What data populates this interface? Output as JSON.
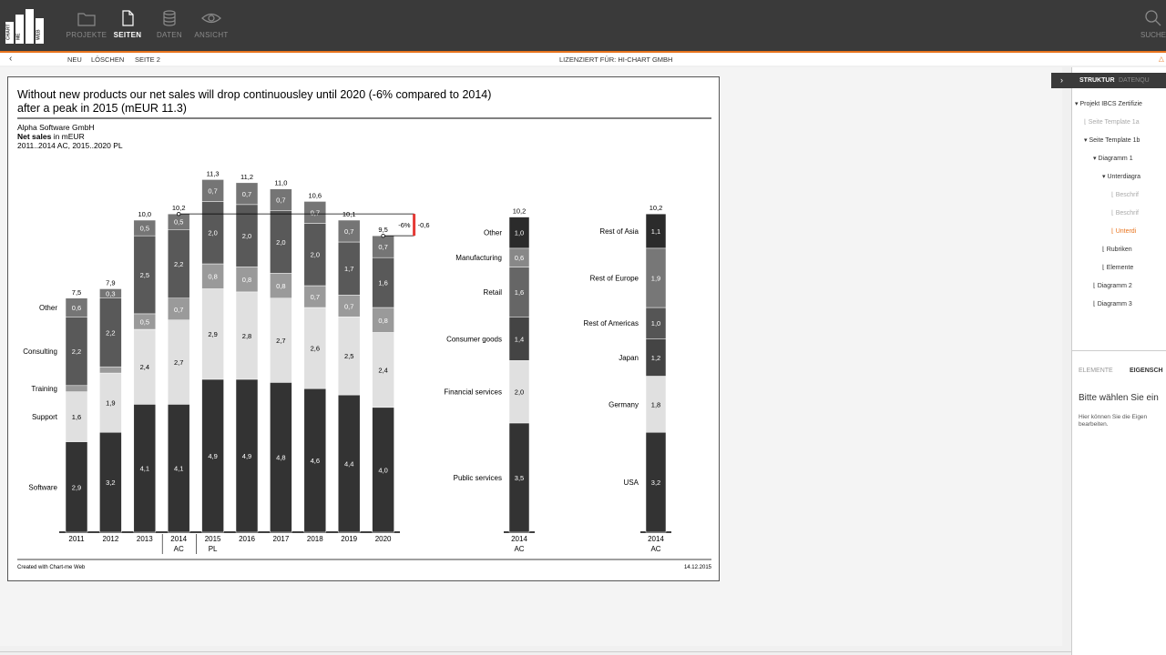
{
  "app": {
    "nav": [
      {
        "label": "PROJEKTE",
        "icon": "folder-icon",
        "active": false
      },
      {
        "label": "SEITEN",
        "icon": "page-icon",
        "active": true
      },
      {
        "label": "DATEN",
        "icon": "database-icon",
        "active": false
      },
      {
        "label": "ANSICHT",
        "icon": "eye-icon",
        "active": false
      }
    ],
    "search_label": "SUCHE",
    "accent_color": "#e8741e"
  },
  "subbar": {
    "new": "NEU",
    "delete": "LÖSCHEN",
    "page": "SEITE 2",
    "license": "LIZENZIERT FÜR: HI-CHART GMBH"
  },
  "right_panel": {
    "tabs": [
      "STRUKTUR",
      "DATENQU"
    ],
    "tree": [
      {
        "label": "Projekt IBCS Zertifizie",
        "level": 0,
        "state": "open"
      },
      {
        "label": "Seite Template 1a",
        "level": 1,
        "state": "leaf-muted"
      },
      {
        "label": "Seite Template 1b",
        "level": 1,
        "state": "open"
      },
      {
        "label": "Diagramm 1",
        "level": 2,
        "state": "open"
      },
      {
        "label": "Unterdiagra",
        "level": 3,
        "state": "open"
      },
      {
        "label": "Beschrif",
        "level": 4,
        "state": "leaf-muted"
      },
      {
        "label": "Beschrif",
        "level": 4,
        "state": "leaf-muted"
      },
      {
        "label": "Unterdi",
        "level": 4,
        "state": "leaf-active"
      },
      {
        "label": "Rubriken",
        "level": 3,
        "state": "leaf"
      },
      {
        "label": "Elemente",
        "level": 3,
        "state": "leaf"
      },
      {
        "label": "Diagramm 2",
        "level": 2,
        "state": "leaf"
      },
      {
        "label": "Diagramm 3",
        "level": 2,
        "state": "leaf"
      }
    ],
    "bottom_tabs": [
      "ELEMENTE",
      "EIGENSCH"
    ],
    "prompt_title": "Bitte wählen Sie ein",
    "prompt_text": "Hier können Sie die Eigen bearbeiten."
  },
  "chart_data": {
    "type": "bar",
    "title": "Without new products our net sales will drop continuousley until 2020 (-6% compared to 2014) after a peak in 2015 (mEUR 11.3)",
    "title_lines": [
      "Without new products our net sales will drop continuousley until 2020 (-6% compared to 2014)",
      "after a peak in 2015 (mEUR 11.3)"
    ],
    "company": "Alpha Software GmbH",
    "measure_bold": "Net sales",
    "measure_rest": " in mEUR",
    "period": "2011..2014 AC, 2015..2020 PL",
    "footer_left": "Created with Chart-me Web",
    "footer_right": "14.12.2015",
    "main": {
      "categories": [
        "2011",
        "2012",
        "2013",
        "2014",
        "2015",
        "2016",
        "2017",
        "2018",
        "2019",
        "2020"
      ],
      "sublabels": [
        "",
        "",
        "",
        "AC",
        "PL",
        "",
        "",
        "",
        "",
        ""
      ],
      "series": [
        {
          "name": "Software",
          "color": "#333333",
          "values": [
            2.9,
            3.2,
            4.1,
            4.1,
            4.9,
            4.9,
            4.8,
            4.6,
            4.4,
            4.0
          ]
        },
        {
          "name": "Support",
          "color": "#e0e0e0",
          "values": [
            1.6,
            null,
            null,
            null,
            null,
            null,
            null,
            null,
            null,
            null
          ]
        },
        {
          "name": "Training",
          "color": "#9a9a9a",
          "values": [
            0.2,
            null,
            null,
            null,
            null,
            null,
            null,
            null,
            null,
            null
          ]
        },
        {
          "name": "Consulting",
          "color": "#595959",
          "values": [
            2.2,
            null,
            null,
            null,
            null,
            null,
            null,
            null,
            null,
            null
          ]
        },
        {
          "name": "Other",
          "color": "#757575",
          "values": [
            0.6,
            null,
            null,
            null,
            null,
            null,
            null,
            null,
            null,
            null
          ]
        }
      ],
      "stacks": [
        [
          2.9,
          1.6,
          0.2,
          2.2,
          0.6
        ],
        [
          3.2,
          1.9,
          0.2,
          2.2,
          0.3
        ],
        [
          4.1,
          2.4,
          0.5,
          2.5,
          0.5
        ],
        [
          4.1,
          2.7,
          0.7,
          2.2,
          0.5
        ],
        [
          4.9,
          2.9,
          0.8,
          2.0,
          0.7
        ],
        [
          4.9,
          2.8,
          0.8,
          2.0,
          0.7
        ],
        [
          4.8,
          2.7,
          0.8,
          2.0,
          0.7
        ],
        [
          4.6,
          2.6,
          0.7,
          2.0,
          0.7
        ],
        [
          4.4,
          2.5,
          0.7,
          1.7,
          0.7
        ],
        [
          4.0,
          2.4,
          0.8,
          1.6,
          0.7
        ]
      ],
      "stack_labels": [
        [
          "2,9",
          "1,6",
          "",
          "2,2",
          "0,6"
        ],
        [
          "3,2",
          "1,9",
          "",
          "2,2",
          "0,3"
        ],
        [
          "4,1",
          "2,4",
          "0,5",
          "2,5",
          "0,5"
        ],
        [
          "4,1",
          "2,7",
          "0,7",
          "2,2",
          "0,5"
        ],
        [
          "4,9",
          "2,9",
          "0,8",
          "2,0",
          "0,7"
        ],
        [
          "4,9",
          "2,8",
          "0,8",
          "2,0",
          "0,7"
        ],
        [
          "4,8",
          "2,7",
          "0,8",
          "2,0",
          "0,7"
        ],
        [
          "4,6",
          "2,6",
          "0,7",
          "2,0",
          "0,7"
        ],
        [
          "4,4",
          "2,5",
          "0,7",
          "1,7",
          "0,7"
        ],
        [
          "4,0",
          "2,4",
          "0,8",
          "1,6",
          "0,7"
        ]
      ],
      "totals": [
        7.5,
        7.9,
        10.0,
        10.2,
        11.3,
        11.2,
        11.0,
        10.6,
        10.1,
        9.5
      ],
      "total_labels": [
        "7,5",
        "7,9",
        "10,0",
        "10,2",
        "11,3",
        "11,2",
        "11,0",
        "10,6",
        "10,1",
        "9,5"
      ],
      "segment_colors": [
        "#333333",
        "#e0e0e0",
        "#9a9a9a",
        "#595959",
        "#757575"
      ],
      "series_labels": [
        "Software",
        "Support",
        "Training",
        "Consulting",
        "Other"
      ],
      "variance": {
        "percent_label": "-6%",
        "value_label": "-0,6",
        "from": "2014",
        "to": "2020",
        "color": "#e53935"
      }
    },
    "industry": {
      "category": "2014",
      "sublabel": "AC",
      "total_label": "10,2",
      "total": 10.2,
      "segments": [
        {
          "name": "Public services",
          "value": 3.5,
          "label": "3,5",
          "color": "#333333"
        },
        {
          "name": "Financial services",
          "value": 2.0,
          "label": "2,0",
          "color": "#e0e0e0"
        },
        {
          "name": "Consumer goods",
          "value": 1.4,
          "label": "1,4",
          "color": "#444444"
        },
        {
          "name": "Retail",
          "value": 1.6,
          "label": "1,6",
          "color": "#666666"
        },
        {
          "name": "Manufacturing",
          "value": 0.6,
          "label": "0,6",
          "color": "#888888"
        },
        {
          "name": "Other",
          "value": 1.0,
          "label": "1,0",
          "color": "#2b2b2b"
        }
      ]
    },
    "region": {
      "category": "2014",
      "sublabel": "AC",
      "total_label": "10,2",
      "total": 10.2,
      "segments": [
        {
          "name": "USA",
          "value": 3.2,
          "label": "3,2",
          "color": "#333333"
        },
        {
          "name": "Germany",
          "value": 1.8,
          "label": "1,8",
          "color": "#e0e0e0"
        },
        {
          "name": "Japan",
          "value": 1.2,
          "label": "1,2",
          "color": "#444444"
        },
        {
          "name": "Rest of Americas",
          "value": 1.0,
          "label": "1,0",
          "color": "#555555"
        },
        {
          "name": "Rest of Europe",
          "value": 1.9,
          "label": "1,9",
          "color": "#777777"
        },
        {
          "name": "Rest of Asia",
          "value": 1.1,
          "label": "1,1",
          "color": "#2b2b2b"
        }
      ]
    }
  }
}
